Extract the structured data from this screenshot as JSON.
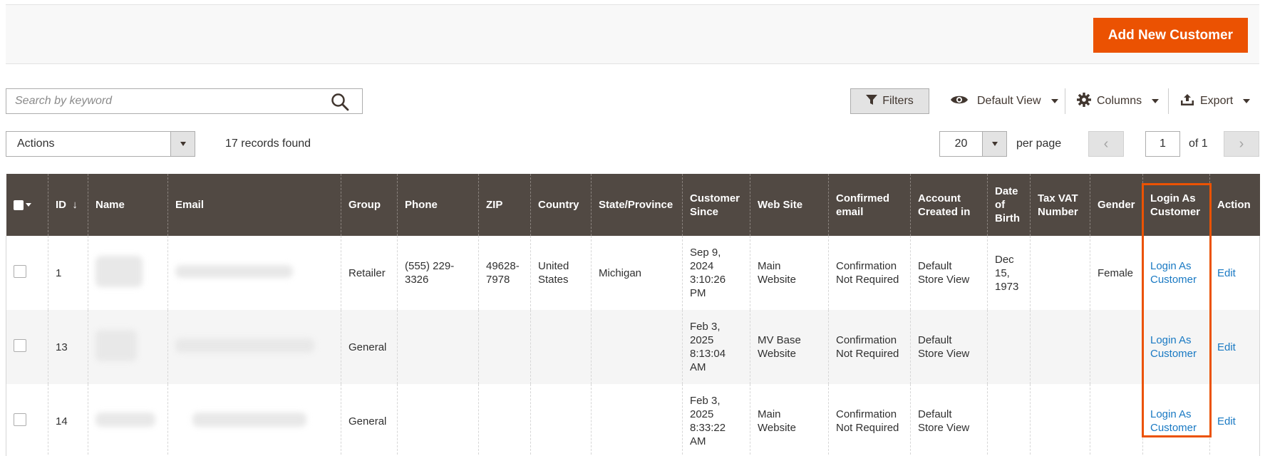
{
  "header": {
    "add_button": "Add New Customer"
  },
  "search": {
    "placeholder": "Search by keyword"
  },
  "toolbar": {
    "filters": "Filters",
    "default_view": "Default View",
    "columns": "Columns",
    "export": "Export"
  },
  "mass_actions": {
    "label": "Actions"
  },
  "records_found": "17 records found",
  "pager": {
    "per_page_value": "20",
    "per_page_label": "per page",
    "current_page": "1",
    "of_label": "of 1"
  },
  "colors": {
    "accent": "#eb5202",
    "header_bg": "#514943",
    "link": "#1979c3"
  },
  "table": {
    "columns": [
      "ID",
      "Name",
      "Email",
      "Group",
      "Phone",
      "ZIP",
      "Country",
      "State/Province",
      "Customer Since",
      "Web Site",
      "Confirmed email",
      "Account Created in",
      "Date of Birth",
      "Tax VAT Number",
      "Gender",
      "Login As Customer",
      "Action"
    ],
    "sort_indicator": "↓",
    "rows": [
      {
        "id": "1",
        "group": "Retailer",
        "phone": "(555) 229-3326",
        "zip": "49628-7978",
        "country": "United States",
        "state": "Michigan",
        "since": "Sep 9, 2024 3:10:26 PM",
        "website": "Main Website",
        "confirmed": "Confirmation Not Required",
        "created_in": "Default Store View",
        "dob": "Dec 15, 1973",
        "taxvat": "",
        "gender": "Female",
        "login": "Login As Customer",
        "action": "Edit"
      },
      {
        "id": "13",
        "group": "General",
        "phone": "",
        "zip": "",
        "country": "",
        "state": "",
        "since": "Feb 3, 2025 8:13:04 AM",
        "website": "MV Base Website",
        "confirmed": "Confirmation Not Required",
        "created_in": "Default Store View",
        "dob": "",
        "taxvat": "",
        "gender": "",
        "login": "Login As Customer",
        "action": "Edit"
      },
      {
        "id": "14",
        "group": "General",
        "phone": "",
        "zip": "",
        "country": "",
        "state": "",
        "since": "Feb 3, 2025 8:33:22 AM",
        "website": "Main Website",
        "confirmed": "Confirmation Not Required",
        "created_in": "Default Store View",
        "dob": "",
        "taxvat": "",
        "gender": "",
        "login": "Login As Customer",
        "action": "Edit"
      }
    ]
  }
}
